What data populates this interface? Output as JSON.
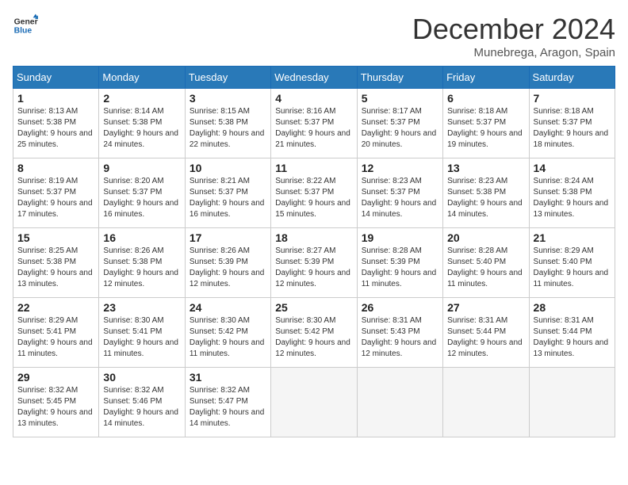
{
  "logo": {
    "line1": "General",
    "line2": "Blue"
  },
  "title": "December 2024",
  "location": "Munebrega, Aragon, Spain",
  "weekdays": [
    "Sunday",
    "Monday",
    "Tuesday",
    "Wednesday",
    "Thursday",
    "Friday",
    "Saturday"
  ],
  "weeks": [
    [
      {
        "day": "1",
        "sunrise": "8:13 AM",
        "sunset": "5:38 PM",
        "daylight": "9 hours and 25 minutes."
      },
      {
        "day": "2",
        "sunrise": "8:14 AM",
        "sunset": "5:38 PM",
        "daylight": "9 hours and 24 minutes."
      },
      {
        "day": "3",
        "sunrise": "8:15 AM",
        "sunset": "5:38 PM",
        "daylight": "9 hours and 22 minutes."
      },
      {
        "day": "4",
        "sunrise": "8:16 AM",
        "sunset": "5:37 PM",
        "daylight": "9 hours and 21 minutes."
      },
      {
        "day": "5",
        "sunrise": "8:17 AM",
        "sunset": "5:37 PM",
        "daylight": "9 hours and 20 minutes."
      },
      {
        "day": "6",
        "sunrise": "8:18 AM",
        "sunset": "5:37 PM",
        "daylight": "9 hours and 19 minutes."
      },
      {
        "day": "7",
        "sunrise": "8:18 AM",
        "sunset": "5:37 PM",
        "daylight": "9 hours and 18 minutes."
      }
    ],
    [
      {
        "day": "8",
        "sunrise": "8:19 AM",
        "sunset": "5:37 PM",
        "daylight": "9 hours and 17 minutes."
      },
      {
        "day": "9",
        "sunrise": "8:20 AM",
        "sunset": "5:37 PM",
        "daylight": "9 hours and 16 minutes."
      },
      {
        "day": "10",
        "sunrise": "8:21 AM",
        "sunset": "5:37 PM",
        "daylight": "9 hours and 16 minutes."
      },
      {
        "day": "11",
        "sunrise": "8:22 AM",
        "sunset": "5:37 PM",
        "daylight": "9 hours and 15 minutes."
      },
      {
        "day": "12",
        "sunrise": "8:23 AM",
        "sunset": "5:37 PM",
        "daylight": "9 hours and 14 minutes."
      },
      {
        "day": "13",
        "sunrise": "8:23 AM",
        "sunset": "5:38 PM",
        "daylight": "9 hours and 14 minutes."
      },
      {
        "day": "14",
        "sunrise": "8:24 AM",
        "sunset": "5:38 PM",
        "daylight": "9 hours and 13 minutes."
      }
    ],
    [
      {
        "day": "15",
        "sunrise": "8:25 AM",
        "sunset": "5:38 PM",
        "daylight": "9 hours and 13 minutes."
      },
      {
        "day": "16",
        "sunrise": "8:26 AM",
        "sunset": "5:38 PM",
        "daylight": "9 hours and 12 minutes."
      },
      {
        "day": "17",
        "sunrise": "8:26 AM",
        "sunset": "5:39 PM",
        "daylight": "9 hours and 12 minutes."
      },
      {
        "day": "18",
        "sunrise": "8:27 AM",
        "sunset": "5:39 PM",
        "daylight": "9 hours and 12 minutes."
      },
      {
        "day": "19",
        "sunrise": "8:28 AM",
        "sunset": "5:39 PM",
        "daylight": "9 hours and 11 minutes."
      },
      {
        "day": "20",
        "sunrise": "8:28 AM",
        "sunset": "5:40 PM",
        "daylight": "9 hours and 11 minutes."
      },
      {
        "day": "21",
        "sunrise": "8:29 AM",
        "sunset": "5:40 PM",
        "daylight": "9 hours and 11 minutes."
      }
    ],
    [
      {
        "day": "22",
        "sunrise": "8:29 AM",
        "sunset": "5:41 PM",
        "daylight": "9 hours and 11 minutes."
      },
      {
        "day": "23",
        "sunrise": "8:30 AM",
        "sunset": "5:41 PM",
        "daylight": "9 hours and 11 minutes."
      },
      {
        "day": "24",
        "sunrise": "8:30 AM",
        "sunset": "5:42 PM",
        "daylight": "9 hours and 11 minutes."
      },
      {
        "day": "25",
        "sunrise": "8:30 AM",
        "sunset": "5:42 PM",
        "daylight": "9 hours and 12 minutes."
      },
      {
        "day": "26",
        "sunrise": "8:31 AM",
        "sunset": "5:43 PM",
        "daylight": "9 hours and 12 minutes."
      },
      {
        "day": "27",
        "sunrise": "8:31 AM",
        "sunset": "5:44 PM",
        "daylight": "9 hours and 12 minutes."
      },
      {
        "day": "28",
        "sunrise": "8:31 AM",
        "sunset": "5:44 PM",
        "daylight": "9 hours and 13 minutes."
      }
    ],
    [
      {
        "day": "29",
        "sunrise": "8:32 AM",
        "sunset": "5:45 PM",
        "daylight": "9 hours and 13 minutes."
      },
      {
        "day": "30",
        "sunrise": "8:32 AM",
        "sunset": "5:46 PM",
        "daylight": "9 hours and 14 minutes."
      },
      {
        "day": "31",
        "sunrise": "8:32 AM",
        "sunset": "5:47 PM",
        "daylight": "9 hours and 14 minutes."
      },
      null,
      null,
      null,
      null
    ]
  ]
}
